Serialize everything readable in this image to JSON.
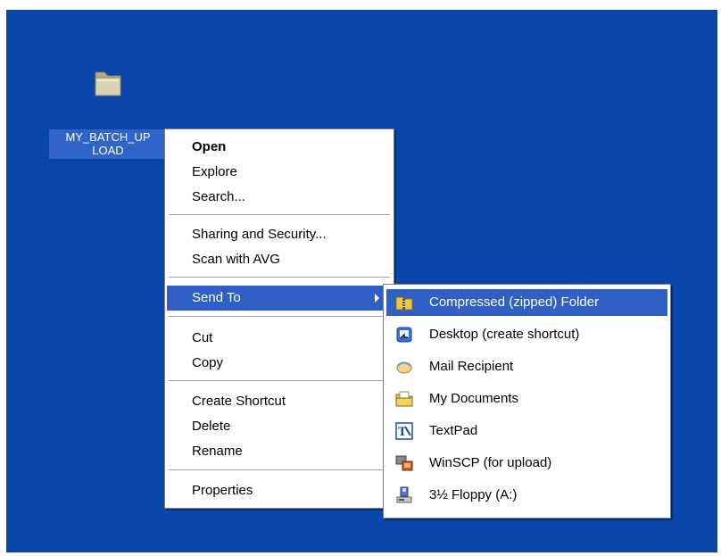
{
  "desktop": {
    "background": "#0a47a8",
    "icon": {
      "name": "folder-icon",
      "label_line1": "MY_BATCH_UP",
      "label_line2": "LOAD"
    }
  },
  "context_menu": {
    "items": [
      {
        "label": "Open",
        "bold": true
      },
      {
        "label": "Explore"
      },
      {
        "label": "Search..."
      },
      {
        "label": "Sharing and Security..."
      },
      {
        "label": "Scan with AVG"
      },
      {
        "label": "Send To",
        "submenu": true,
        "highlighted": true
      },
      {
        "label": "Cut"
      },
      {
        "label": "Copy"
      },
      {
        "label": "Create Shortcut"
      },
      {
        "label": "Delete"
      },
      {
        "label": "Rename"
      },
      {
        "label": "Properties"
      }
    ]
  },
  "send_to_menu": {
    "items": [
      {
        "label": "Compressed (zipped) Folder",
        "icon": "zip-folder-icon",
        "highlighted": true
      },
      {
        "label": "Desktop (create shortcut)",
        "icon": "desktop-shortcut-icon"
      },
      {
        "label": "Mail Recipient",
        "icon": "mail-icon"
      },
      {
        "label": "My Documents",
        "icon": "my-documents-icon"
      },
      {
        "label": "TextPad",
        "icon": "textpad-icon"
      },
      {
        "label": "WinSCP (for upload)",
        "icon": "winscp-icon"
      },
      {
        "label": "3½ Floppy (A:)",
        "icon": "floppy-icon"
      }
    ]
  },
  "colors": {
    "highlight": "#305fc6",
    "selection": "#3164c8"
  }
}
